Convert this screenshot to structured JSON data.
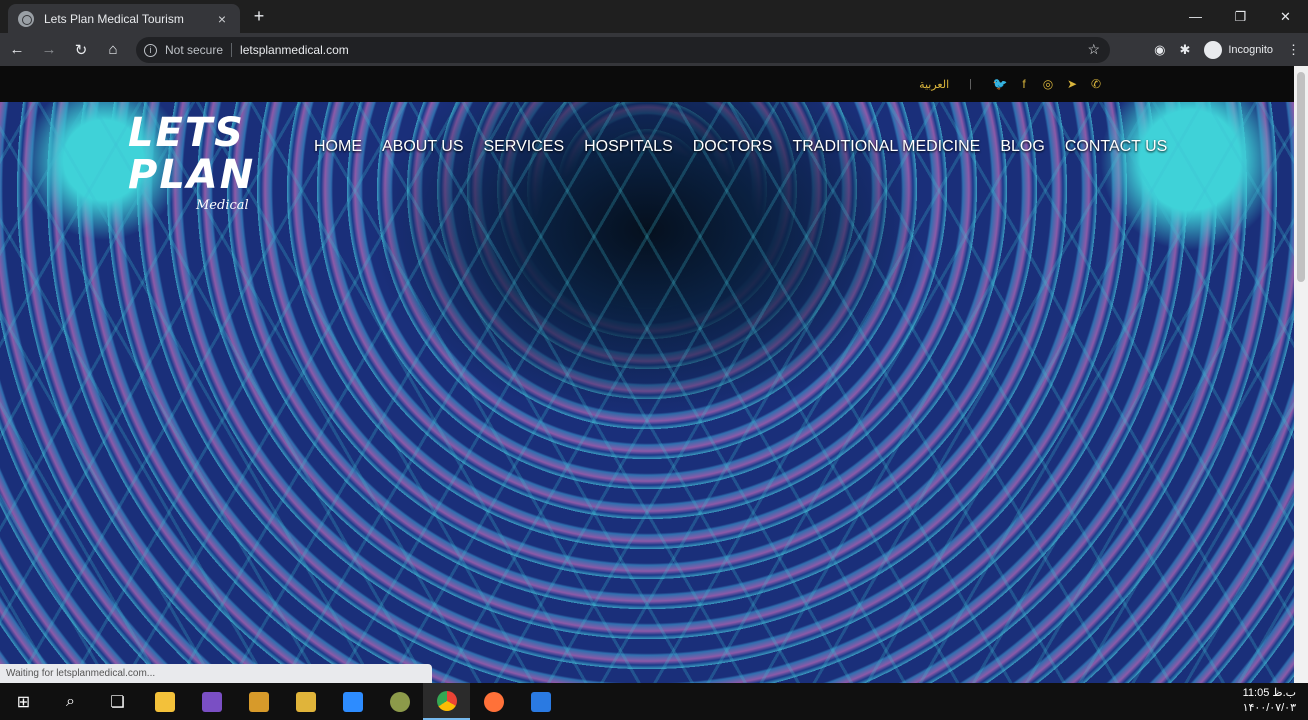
{
  "browser": {
    "tab_title": "Lets Plan Medical Tourism",
    "tab_close": "×",
    "new_tab": "+",
    "window_controls": {
      "minimize": "—",
      "maximize": "❐",
      "close": "✕"
    },
    "nav": {
      "back": "←",
      "forward": "→",
      "reload": "↻",
      "home": "⌂"
    },
    "security_label": "Not secure",
    "url": "letsplanmedical.com",
    "bookmark_icon": "☆",
    "profile_label": "Incognito",
    "menu_icon": "⋮"
  },
  "page": {
    "top_strip": {
      "language_link": "العربية",
      "separator": "|",
      "social_icons": [
        "twitter-icon",
        "facebook-icon",
        "instagram-icon",
        "telegram-icon",
        "whatsapp-icon"
      ],
      "social_glyphs": [
        "🐦",
        "f",
        "◎",
        "➤",
        "✆"
      ]
    },
    "logo": {
      "line1": "LETS",
      "line2": "PLAN",
      "line3": "Medical"
    },
    "nav_items": [
      "HOME",
      "ABOUT US",
      "SERVICES",
      "HOSPITALS",
      "DOCTORS",
      "TRADITIONAL MEDICINE",
      "BLOG",
      "CONTACT US"
    ],
    "status_text": "Waiting for letsplanmedical.com..."
  },
  "taskbar": {
    "apps": [
      "start",
      "search",
      "task-view",
      "file-explorer",
      "visual-studio",
      "app-1",
      "app-2",
      "zoom",
      "app-3",
      "chrome",
      "firefox",
      "app-4"
    ],
    "clock_time": "11:05 ب.ظ",
    "clock_date": "۱۴۰۰/۰۷/۰۳"
  },
  "colors": {
    "accent_gold": "#d8b43c",
    "chrome_dark": "#35363a",
    "tile_cyan": "#3fd2d8"
  }
}
